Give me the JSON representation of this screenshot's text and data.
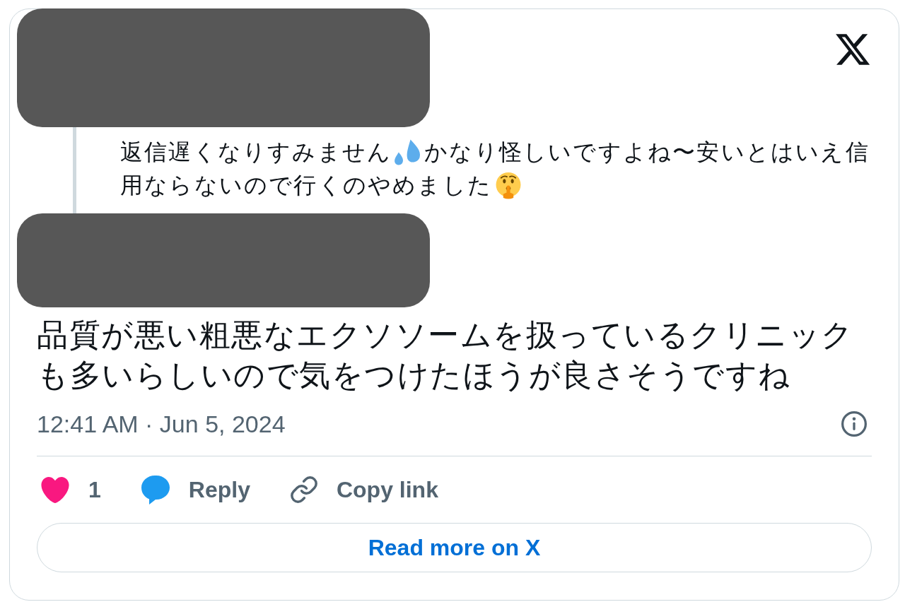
{
  "reply_to": {
    "lines": [
      [
        {
          "kind": "text",
          "text": "返信遅くなりすみません"
        },
        {
          "kind": "sweat"
        },
        {
          "kind": "text",
          "text": "かなり怪しいですよね〜安いとはいえ信"
        }
      ],
      [
        {
          "kind": "text",
          "text": "用ならないので行くのやめました"
        },
        {
          "kind": "shush"
        }
      ]
    ]
  },
  "tweet": {
    "text": "品質が悪い粗悪なエクソソームを扱っているクリニックも多いらしいので気をつけたほうが良さそうですね",
    "timestamp": "12:41 AM · Jun 5, 2024"
  },
  "actions": [
    {
      "kind": "like",
      "label": "1"
    },
    {
      "kind": "reply",
      "label": "Reply"
    },
    {
      "kind": "copy_link",
      "label": "Copy link"
    }
  ],
  "read_more": {
    "label": "Read more on X"
  }
}
